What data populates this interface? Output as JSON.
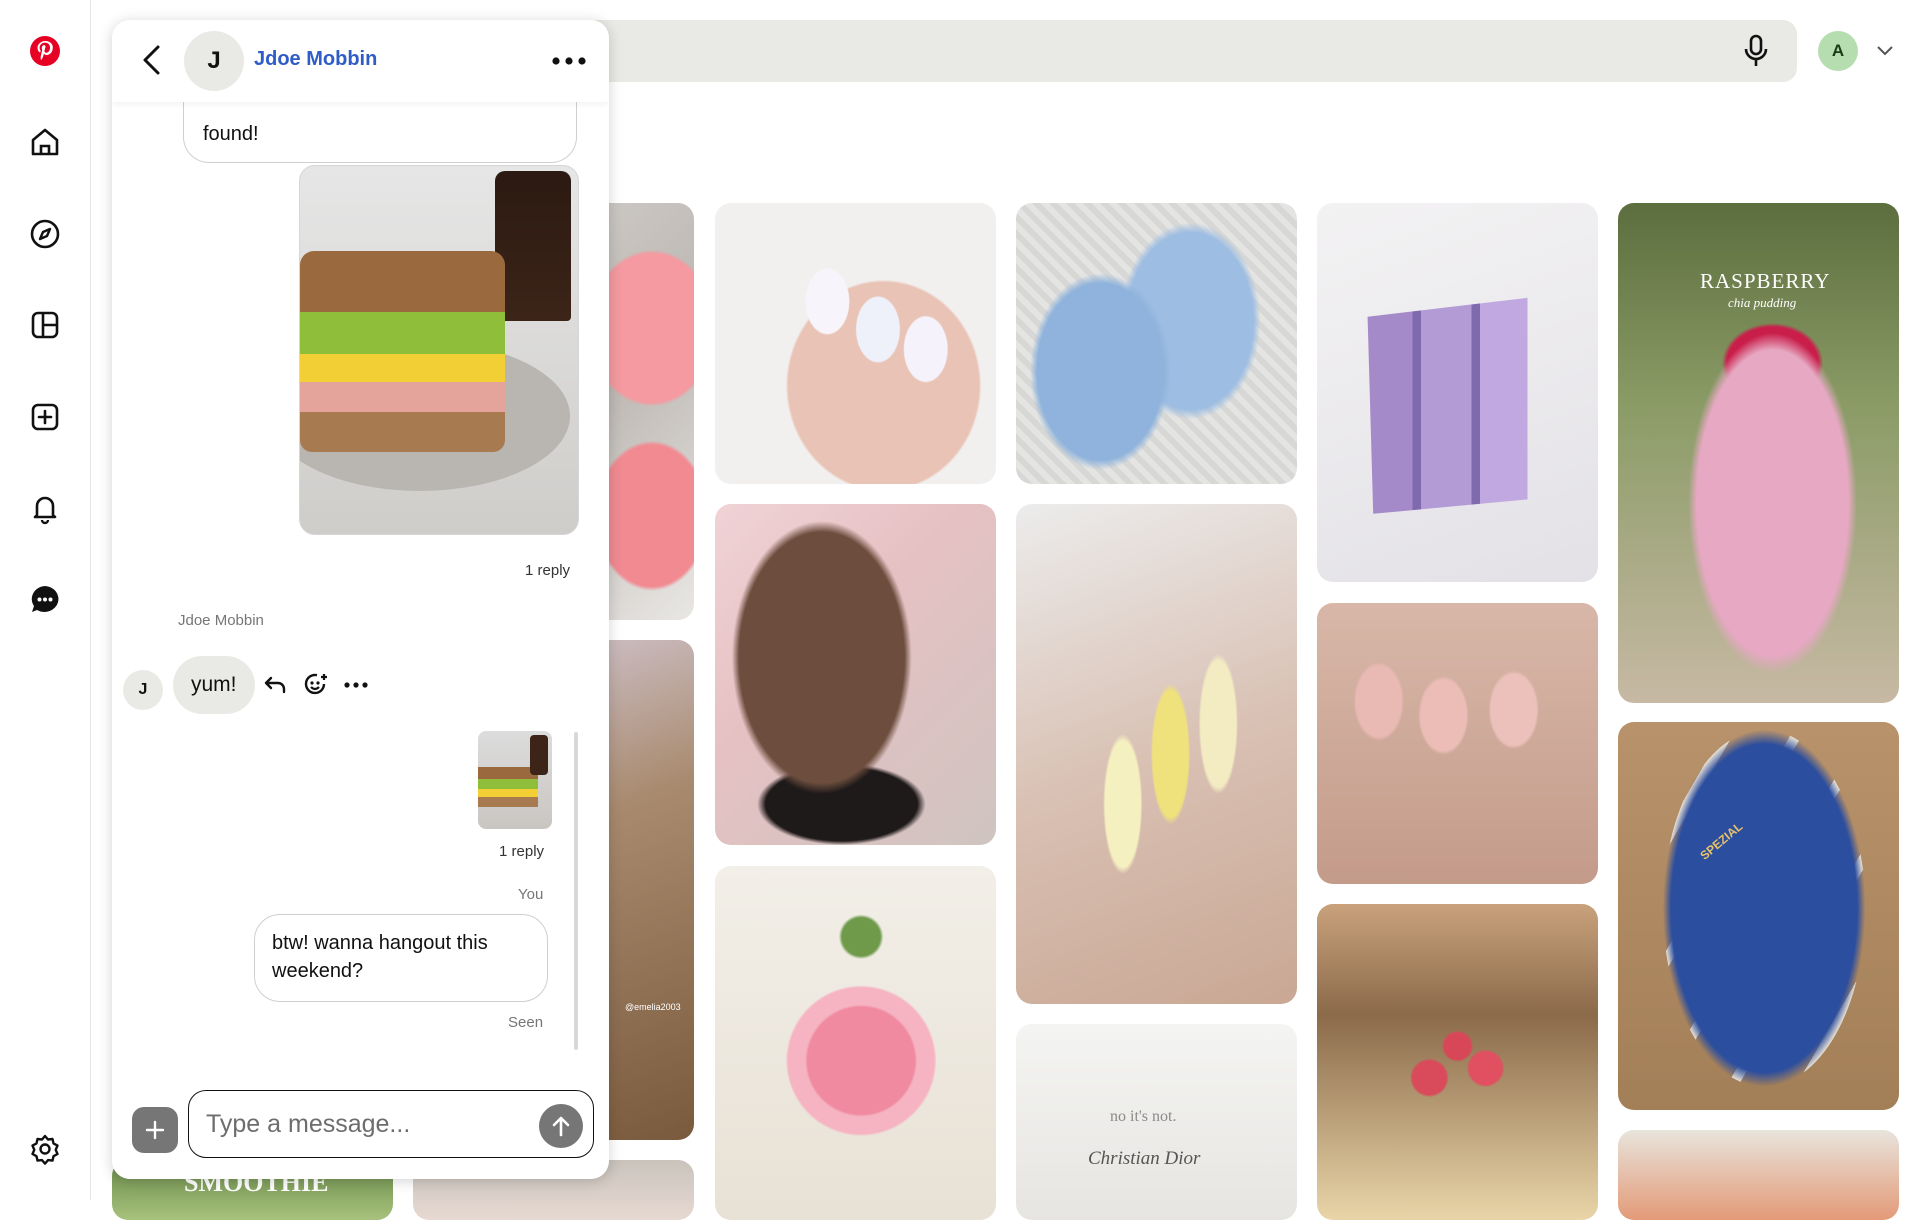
{
  "app": {
    "brand_color": "#e60023",
    "rail": [
      {
        "name": "pinterest-logo-icon"
      },
      {
        "name": "home-icon"
      },
      {
        "name": "explore-icon"
      },
      {
        "name": "boards-icon"
      },
      {
        "name": "create-icon"
      },
      {
        "name": "notifications-icon"
      },
      {
        "name": "messages-icon"
      },
      {
        "name": "settings-icon"
      }
    ]
  },
  "topbar": {
    "account_initial": "A",
    "account_color": "#b6ddb0"
  },
  "pins": {
    "col5_top_caption": "RASPBERRY",
    "col5_top_subcaption": "chia pudding",
    "bag_caption": "no it's not.",
    "bag_brand": "Christian Dior",
    "smoothie_caption": "SMOOTHIE",
    "sneaker_text": "SPEZIAL",
    "watermark": "@emelia2003"
  },
  "chat": {
    "contact_initial": "J",
    "contact_name": "Jdoe Mobbin",
    "messages": {
      "partial_bubble_text": "found!",
      "image_reply_count": "1 reply",
      "sender_label": "Jdoe Mobbin",
      "incoming_text": "yum!",
      "thumb_reply_count": "1 reply",
      "you_label": "You",
      "outgoing_text": "btw! wanna hangout this weekend?",
      "status": "Seen"
    },
    "composer": {
      "placeholder": "Type a message..."
    }
  }
}
